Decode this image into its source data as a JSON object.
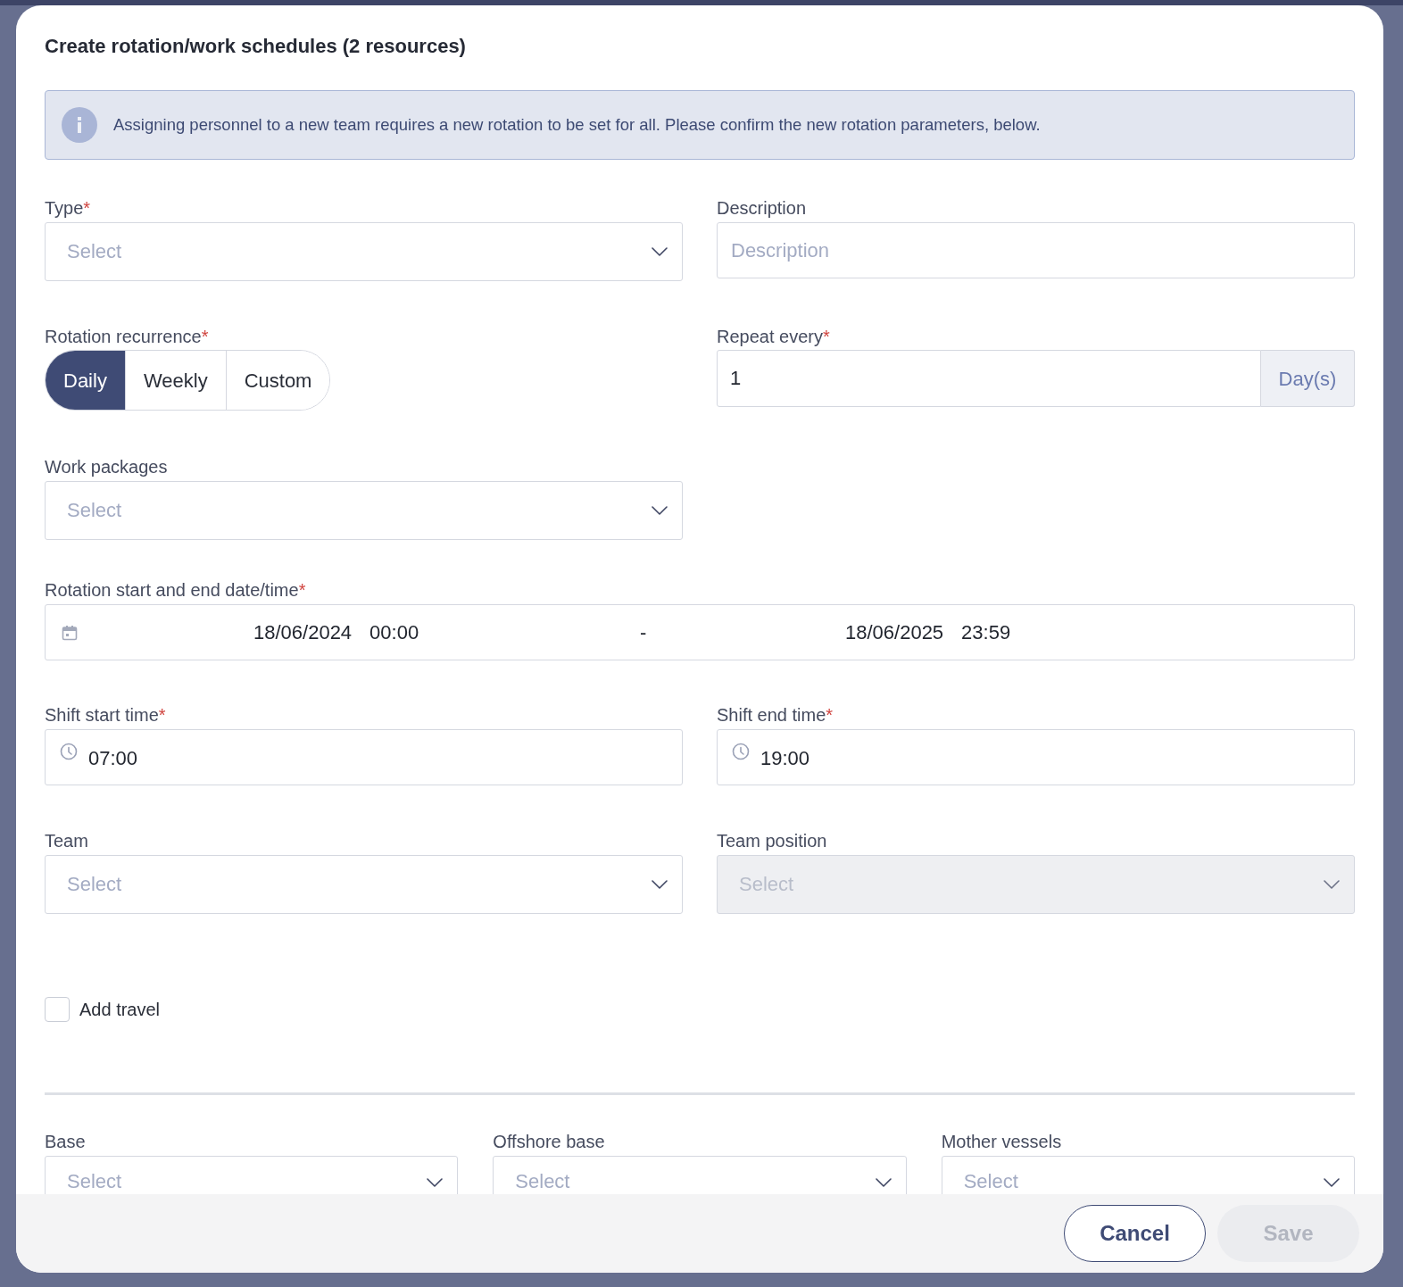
{
  "dialog": {
    "title": "Create rotation/work schedules (2 resources)"
  },
  "info": {
    "text": "Assigning personnel to a new team requires a new rotation to be set for all. Please confirm the new rotation parameters, below."
  },
  "type_field": {
    "label": "Type",
    "required_mark": "*",
    "placeholder": "Select"
  },
  "description_field": {
    "label": "Description",
    "placeholder": "Description"
  },
  "rotation_recurrence": {
    "label": "Rotation recurrence",
    "required_mark": "*",
    "options": [
      {
        "label": "Daily",
        "selected": true
      },
      {
        "label": "Weekly",
        "selected": false
      },
      {
        "label": "Custom",
        "selected": false
      }
    ]
  },
  "repeat_every": {
    "label": "Repeat every",
    "required_mark": "*",
    "value": "1",
    "unit": "Day(s)"
  },
  "work_packages": {
    "label": "Work packages",
    "placeholder": "Select"
  },
  "rotation_dates": {
    "label": "Rotation start and end date/time",
    "required_mark": "*",
    "start_date": "18/06/2024",
    "start_time": "00:00",
    "separator": "-",
    "end_date": "18/06/2025",
    "end_time": "23:59"
  },
  "shift_start": {
    "label": "Shift start time",
    "required_mark": "*",
    "value": "07:00"
  },
  "shift_end": {
    "label": "Shift end time",
    "required_mark": "*",
    "value": "19:00"
  },
  "team": {
    "label": "Team",
    "placeholder": "Select",
    "disabled": false
  },
  "team_position": {
    "label": "Team position",
    "placeholder": "Select",
    "disabled": true
  },
  "add_travel": {
    "label": "Add travel",
    "checked": false
  },
  "locations": [
    {
      "label": "Base",
      "placeholder": "Select"
    },
    {
      "label": "Offshore base",
      "placeholder": "Select"
    },
    {
      "label": "Mother vessels",
      "placeholder": "Select"
    }
  ],
  "footer": {
    "buttons": [
      {
        "label": "Cancel",
        "disabled": false
      },
      {
        "label": "Save",
        "disabled": true
      }
    ]
  }
}
